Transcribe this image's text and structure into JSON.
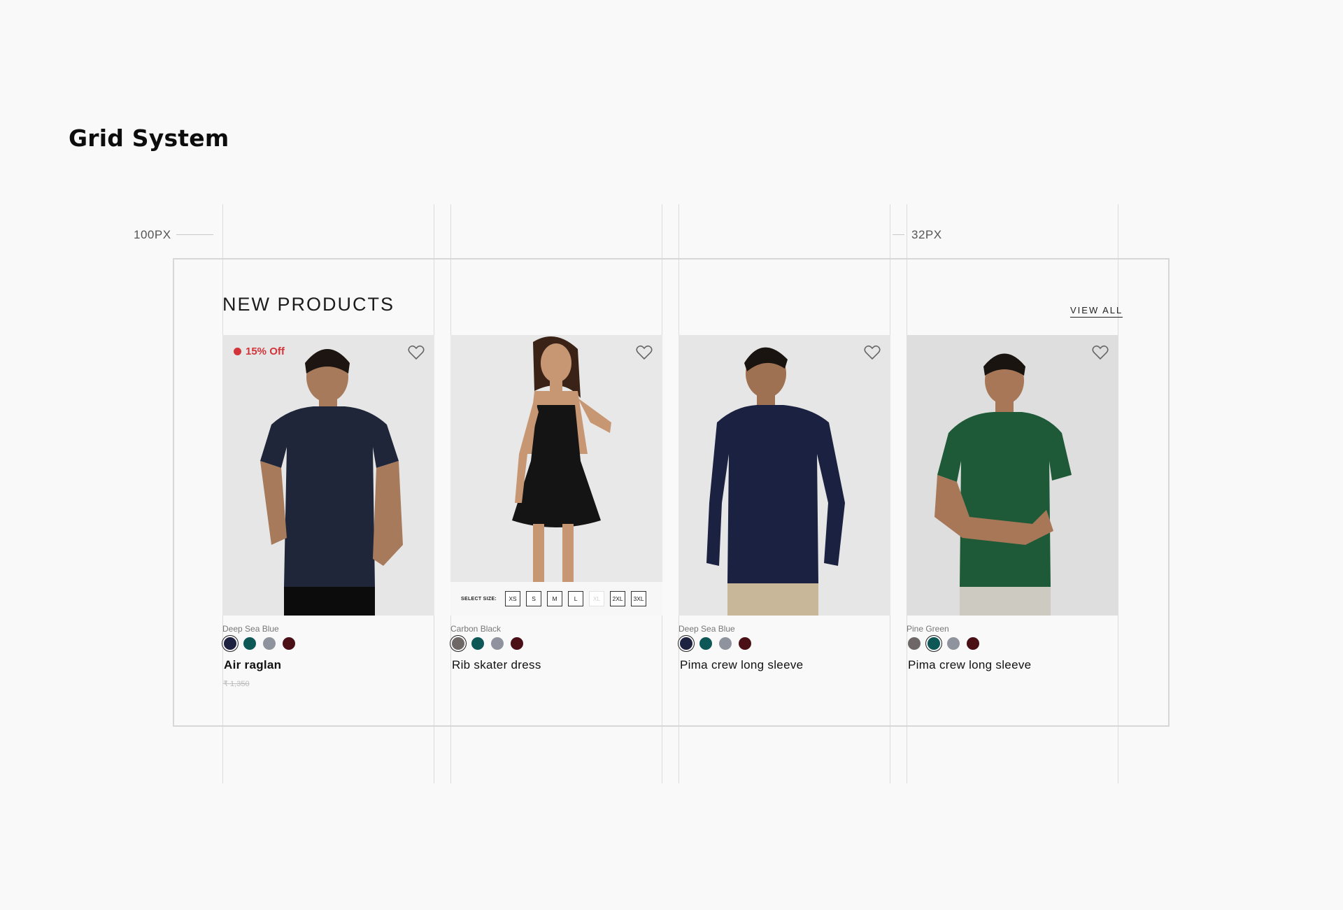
{
  "page": {
    "title": "Grid System"
  },
  "annotations": {
    "margin_label": "100PX",
    "gutter_label": "32PX"
  },
  "section": {
    "title": "NEW PRODUCTS",
    "view_all_label": "VIEW ALL"
  },
  "swatch_colors": [
    "#1c2240",
    "#0d5757",
    "#8f939e",
    "#4a1016",
    "#6d6767"
  ],
  "products": [
    {
      "name": "Air raglan",
      "color_name": "Deep Sea Blue",
      "badge": "15% Off",
      "price": "₹ 1,350",
      "garment_color": "#1f2639",
      "selected_swatch_index": 0,
      "swatches": [
        "#1c2240",
        "#0d5757",
        "#8f939e",
        "#4a1016"
      ],
      "icons": [
        "heart-icon",
        "discount-icon"
      ]
    },
    {
      "name": "Rib skater dress",
      "color_name": "Carbon Black",
      "garment_color": "#141414",
      "selected_swatch_index": 0,
      "swatches": [
        "#6d6767",
        "#0d5757",
        "#8f939e",
        "#4a1016"
      ],
      "size_selector": {
        "label": "SELECT SIZE:",
        "sizes": [
          "XS",
          "S",
          "M",
          "L",
          "XL",
          "2XL",
          "3XL"
        ],
        "unavailable": [
          "XL"
        ]
      },
      "icons": [
        "heart-icon"
      ]
    },
    {
      "name": "Pima crew long sleeve",
      "color_name": "Deep Sea Blue",
      "garment_color": "#1b2140",
      "selected_swatch_index": 0,
      "swatches": [
        "#1c2240",
        "#0d5757",
        "#8f939e",
        "#4a1016"
      ],
      "icons": [
        "heart-icon"
      ]
    },
    {
      "name": "Pima crew long sleeve",
      "color_name": "Pine Green",
      "garment_color": "#1e5a38",
      "selected_swatch_index": 1,
      "swatches": [
        "#6d6767",
        "#0d5757",
        "#8f939e",
        "#4a1016"
      ],
      "icons": [
        "heart-icon"
      ]
    }
  ]
}
